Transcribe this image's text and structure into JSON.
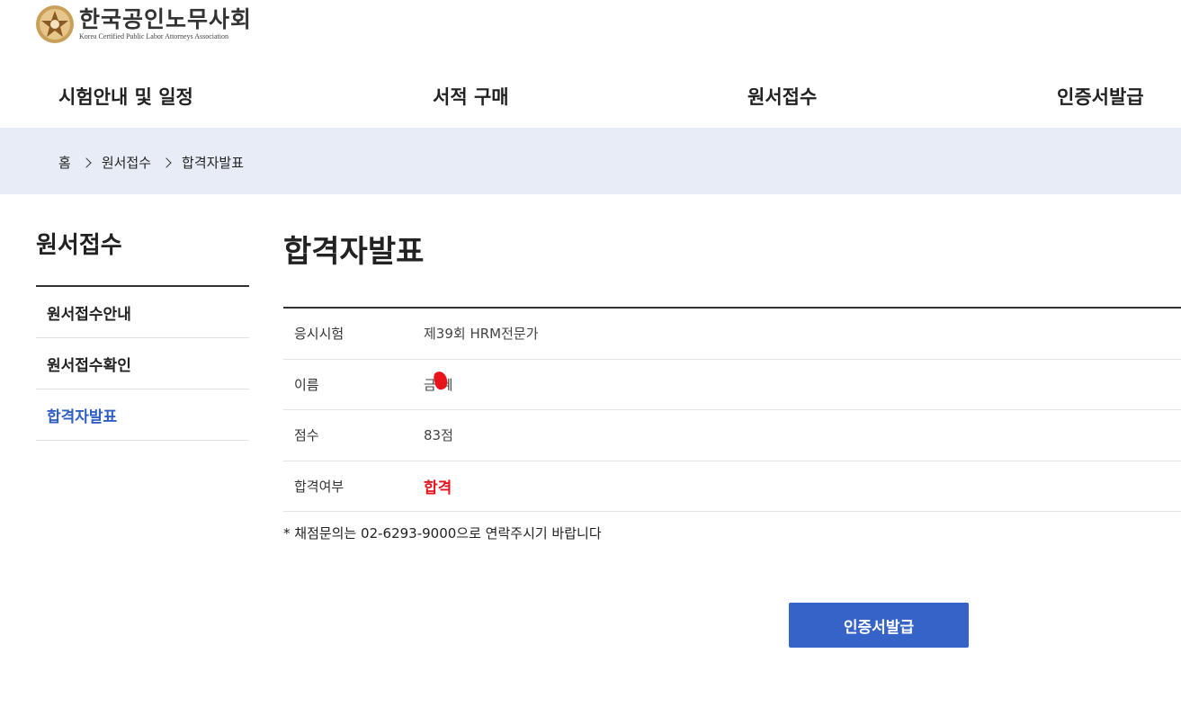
{
  "logo": {
    "name_ko": "한국공인노무사회",
    "name_en": "Korea Certified Public Labor Attorneys Association"
  },
  "nav": {
    "items": [
      {
        "label": "시험안내 및 일정"
      },
      {
        "label": "서적 구매"
      },
      {
        "label": "원서접수"
      },
      {
        "label": "인증서발급"
      }
    ]
  },
  "breadcrumb": {
    "items": [
      "홈",
      "원서접수",
      "합격자발표"
    ]
  },
  "sidebar": {
    "title": "원서접수",
    "items": [
      {
        "label": "원서접수안내",
        "active": false
      },
      {
        "label": "원서접수확인",
        "active": false
      },
      {
        "label": "합격자발표",
        "active": true
      }
    ]
  },
  "main": {
    "title": "합격자발표",
    "rows": [
      {
        "label": "응시시험",
        "value": "제39회 HRM전문가"
      },
      {
        "label": "이름",
        "value": "금  혜"
      },
      {
        "label": "점수",
        "value": "83점"
      },
      {
        "label": "합격여부",
        "value": "합격"
      }
    ],
    "note": "* 채점문의는 02-6293-9000으로 연락주시기 바랍니다",
    "button_label": "인증서발급"
  },
  "colors": {
    "accent": "#3563c8",
    "active_menu": "#2f5fc4",
    "pass": "#e8141b",
    "breadcrumb_bg": "#e7ecf7"
  }
}
